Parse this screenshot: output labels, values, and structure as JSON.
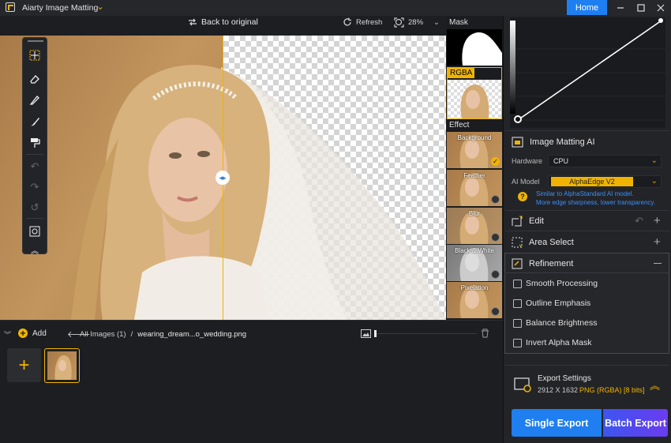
{
  "app": {
    "title": "Aiarty Image Matting",
    "home_label": "Home"
  },
  "toolbar": {
    "back_label": "Back to original",
    "refresh_label": "Refresh",
    "zoom": "28%"
  },
  "strip": {
    "mask_label": "Mask",
    "rgba_label": "RGBA",
    "effect_label": "Effect",
    "effects": [
      {
        "label": "Background",
        "selected": true
      },
      {
        "label": "Feather",
        "selected": false
      },
      {
        "label": "Blur",
        "selected": false
      },
      {
        "label": "Black & White",
        "selected": false
      },
      {
        "label": "Pixelation",
        "selected": false
      }
    ]
  },
  "panel": {
    "matting_title": "Image Matting AI",
    "hardware_label": "Hardware",
    "hardware_value": "CPU",
    "model_label": "AI Model",
    "model_value": "AlphaEdge  V2",
    "model_note_1": "Similar to AlphaStandard AI model.",
    "model_note_2": "More edge sharpness, lower transparency.",
    "edit_title": "Edit",
    "area_select_title": "Area Select",
    "refinement_title": "Refinement",
    "options": [
      {
        "label": "Smooth Processing",
        "checked": false
      },
      {
        "label": "Outline Emphasis",
        "checked": false
      },
      {
        "label": "Balance Brightness",
        "checked": false
      },
      {
        "label": "Invert Alpha Mask",
        "checked": false
      }
    ],
    "export_title": "Export Settings",
    "export_size": "2912 X 1632",
    "export_format": "PNG (RGBA) [8 bits]",
    "single_export": "Single Export",
    "batch_export": "Batch Export"
  },
  "bottom": {
    "add_label": "Add",
    "all_images": "All Images (1)",
    "sep": "/",
    "filename": "wearing_dream...o_wedding.png"
  },
  "colors": {
    "accent": "#f0b400",
    "blue": "#1f7ef0",
    "purple": "#6a3cf0"
  }
}
